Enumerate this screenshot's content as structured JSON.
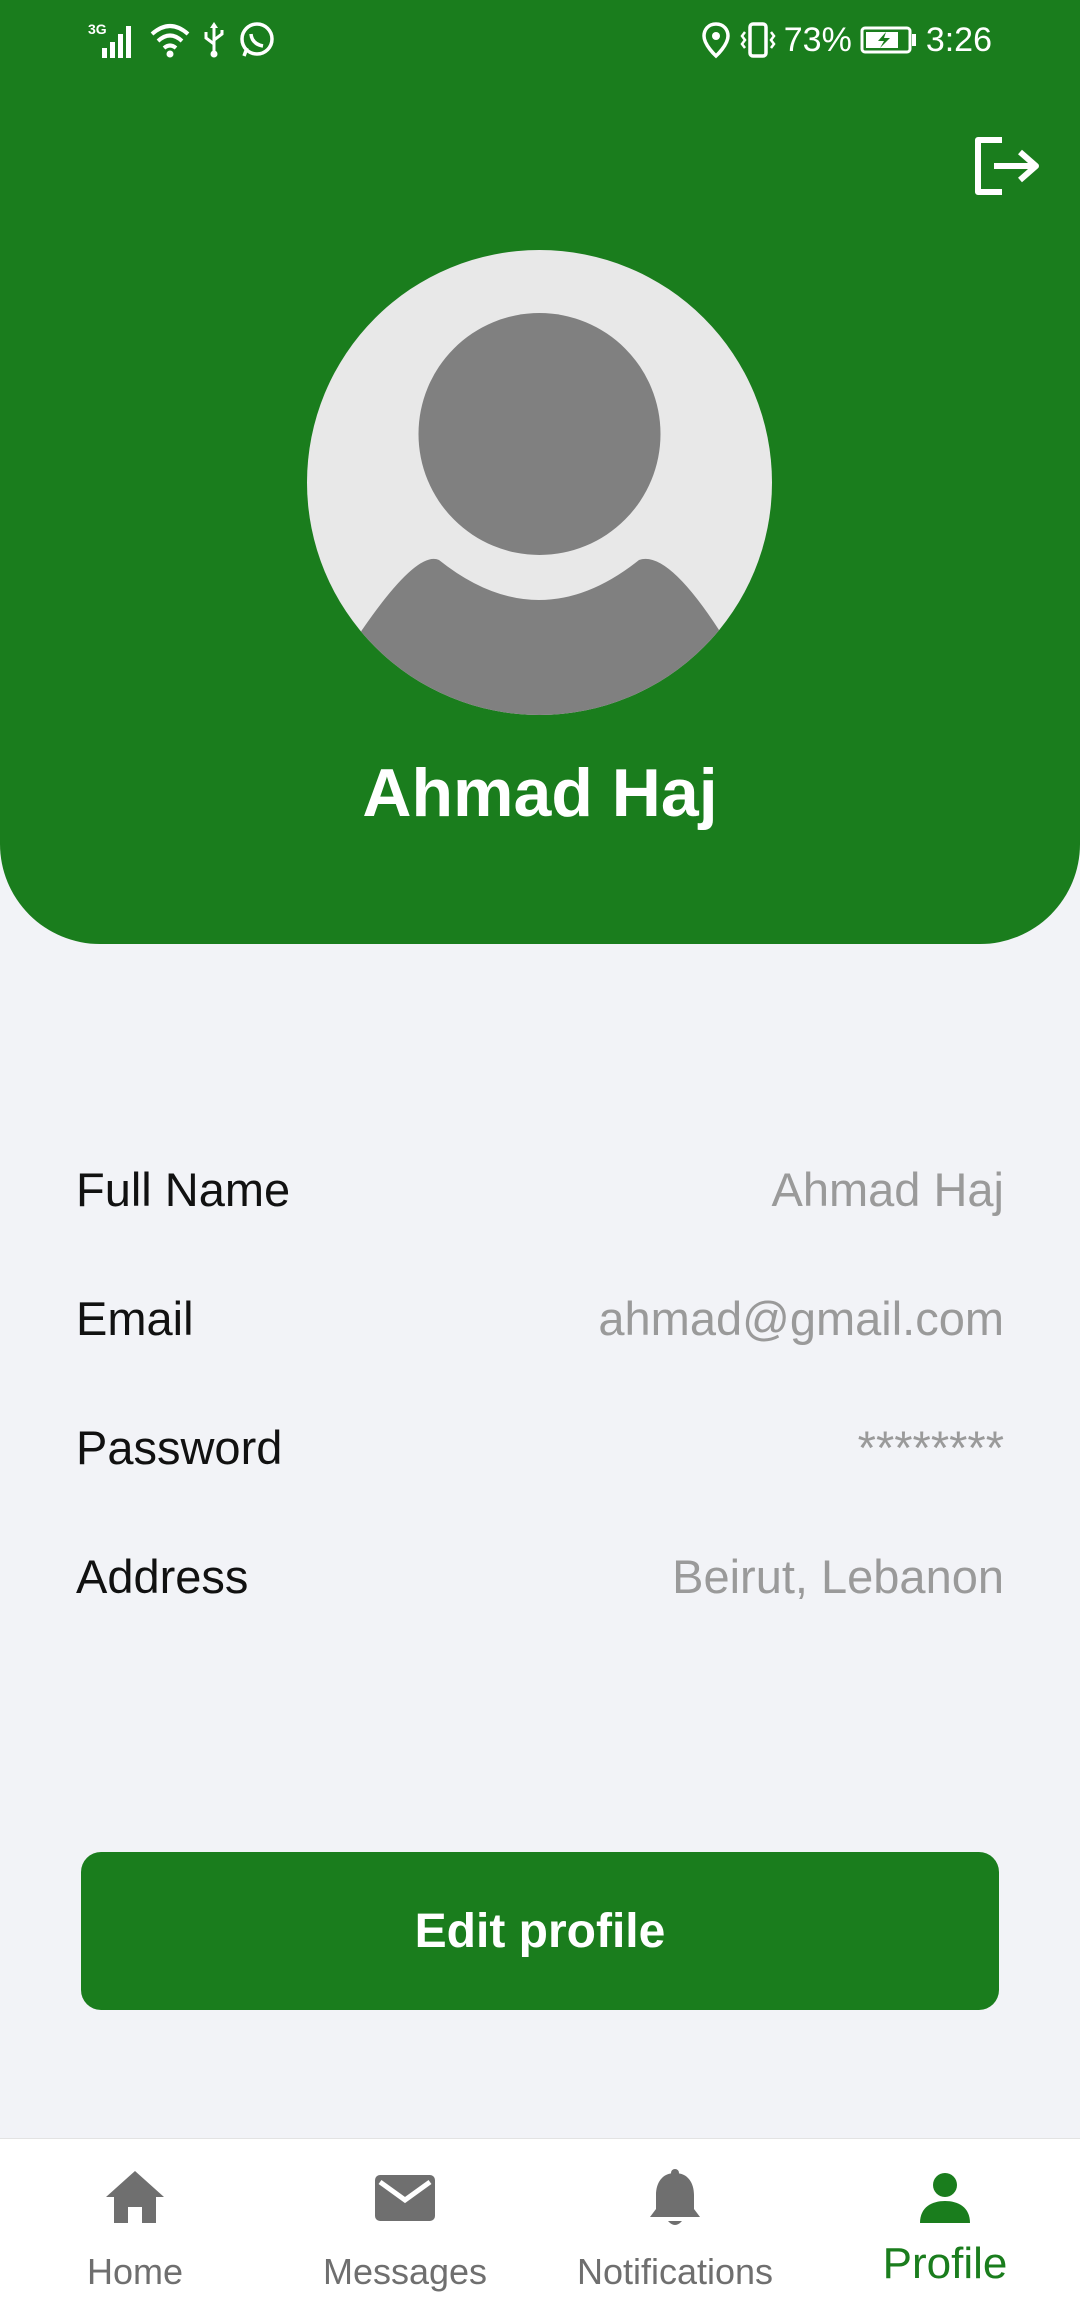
{
  "status_bar": {
    "network": "3G",
    "battery_percent": "73%",
    "time": "3:26"
  },
  "header": {
    "logout_icon": "logout-icon",
    "avatar_icon": "person-placeholder-avatar",
    "name": "Ahmad Haj"
  },
  "info": [
    {
      "label": "Full Name",
      "value": "Ahmad Haj"
    },
    {
      "label": "Email",
      "value": "ahmad@gmail.com"
    },
    {
      "label": "Password",
      "value": "********"
    },
    {
      "label": "Address",
      "value": "Beirut, Lebanon"
    }
  ],
  "edit_button": {
    "label": "Edit profile"
  },
  "bottom_nav": {
    "items": [
      {
        "label": "Home",
        "icon": "home-icon"
      },
      {
        "label": "Messages",
        "icon": "mail-icon"
      },
      {
        "label": "Notifications",
        "icon": "bell-icon"
      },
      {
        "label": "Profile",
        "icon": "person-icon"
      }
    ],
    "active_index": 3
  },
  "colors": {
    "brand_green": "#1a7d1d",
    "background": "#f2f3f7",
    "muted_text": "#9a9a9a",
    "nav_inactive": "#6f6f6f"
  }
}
